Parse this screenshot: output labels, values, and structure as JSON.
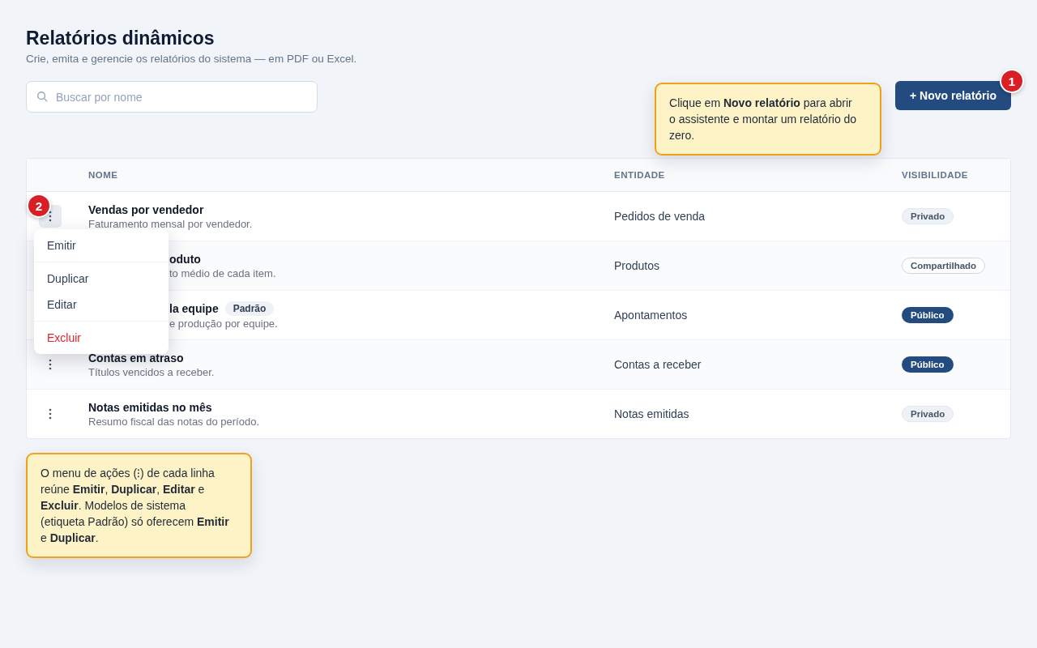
{
  "header": {
    "title": "Relatórios dinâmicos",
    "subtitle": "Crie, emita e gerencie os relatórios do sistema — em PDF ou Excel."
  },
  "search": {
    "placeholder": "Buscar por nome"
  },
  "new_button": {
    "label": "+ Novo relatório",
    "step": "1"
  },
  "hint_top": "Clique em **Novo relatório** para abrir o assistente e montar um relatório do zero.",
  "table": {
    "columns": [
      "NOME",
      "ENTIDADE",
      "VISIBILIDADE"
    ],
    "rows": [
      {
        "name": "Vendas por vendedor",
        "description": "Faturamento mensal por vendedor.",
        "entity": "Pedidos de venda",
        "visibility": "Privado",
        "kind": "private",
        "menu_open": true,
        "covered": false
      },
      {
        "name": "oduto",
        "description": "to médio de cada item.",
        "entity": "Produtos",
        "visibility": "Compartilhado",
        "kind": "shared",
        "menu_open": false,
        "covered": true
      },
      {
        "name": "la equipe",
        "tag": "Padrão",
        "description": "e produção por equipe.",
        "entity": "Apontamentos",
        "visibility": "Público",
        "kind": "public",
        "menu_open": false,
        "covered": true
      },
      {
        "name": "Contas em atraso",
        "description": "Títulos vencidos a receber.",
        "entity": "Contas a receber",
        "visibility": "Público",
        "kind": "public",
        "menu_open": false,
        "covered": false
      },
      {
        "name": "Notas emitidas no mês",
        "description": "Resumo fiscal das notas do período.",
        "entity": "Notas emitidas",
        "visibility": "Privado",
        "kind": "private",
        "menu_open": false,
        "covered": false
      }
    ]
  },
  "action_menu": {
    "step": "2",
    "items": [
      {
        "label": "Emitir",
        "kind": "normal",
        "separator_before": false
      },
      {
        "label": "Duplicar",
        "kind": "normal",
        "separator_before": true
      },
      {
        "label": "Editar",
        "kind": "normal",
        "separator_before": false
      },
      {
        "label": "Excluir",
        "kind": "danger",
        "separator_before": true
      }
    ]
  },
  "hint_bottom": "O menu de ações (⁝) de cada linha reúne **Emitir**, **Duplicar**, **Editar** e **Excluir**. Modelos de sistema (etiqueta Padrão) só oferecem **Emitir** e **Duplicar**."
}
